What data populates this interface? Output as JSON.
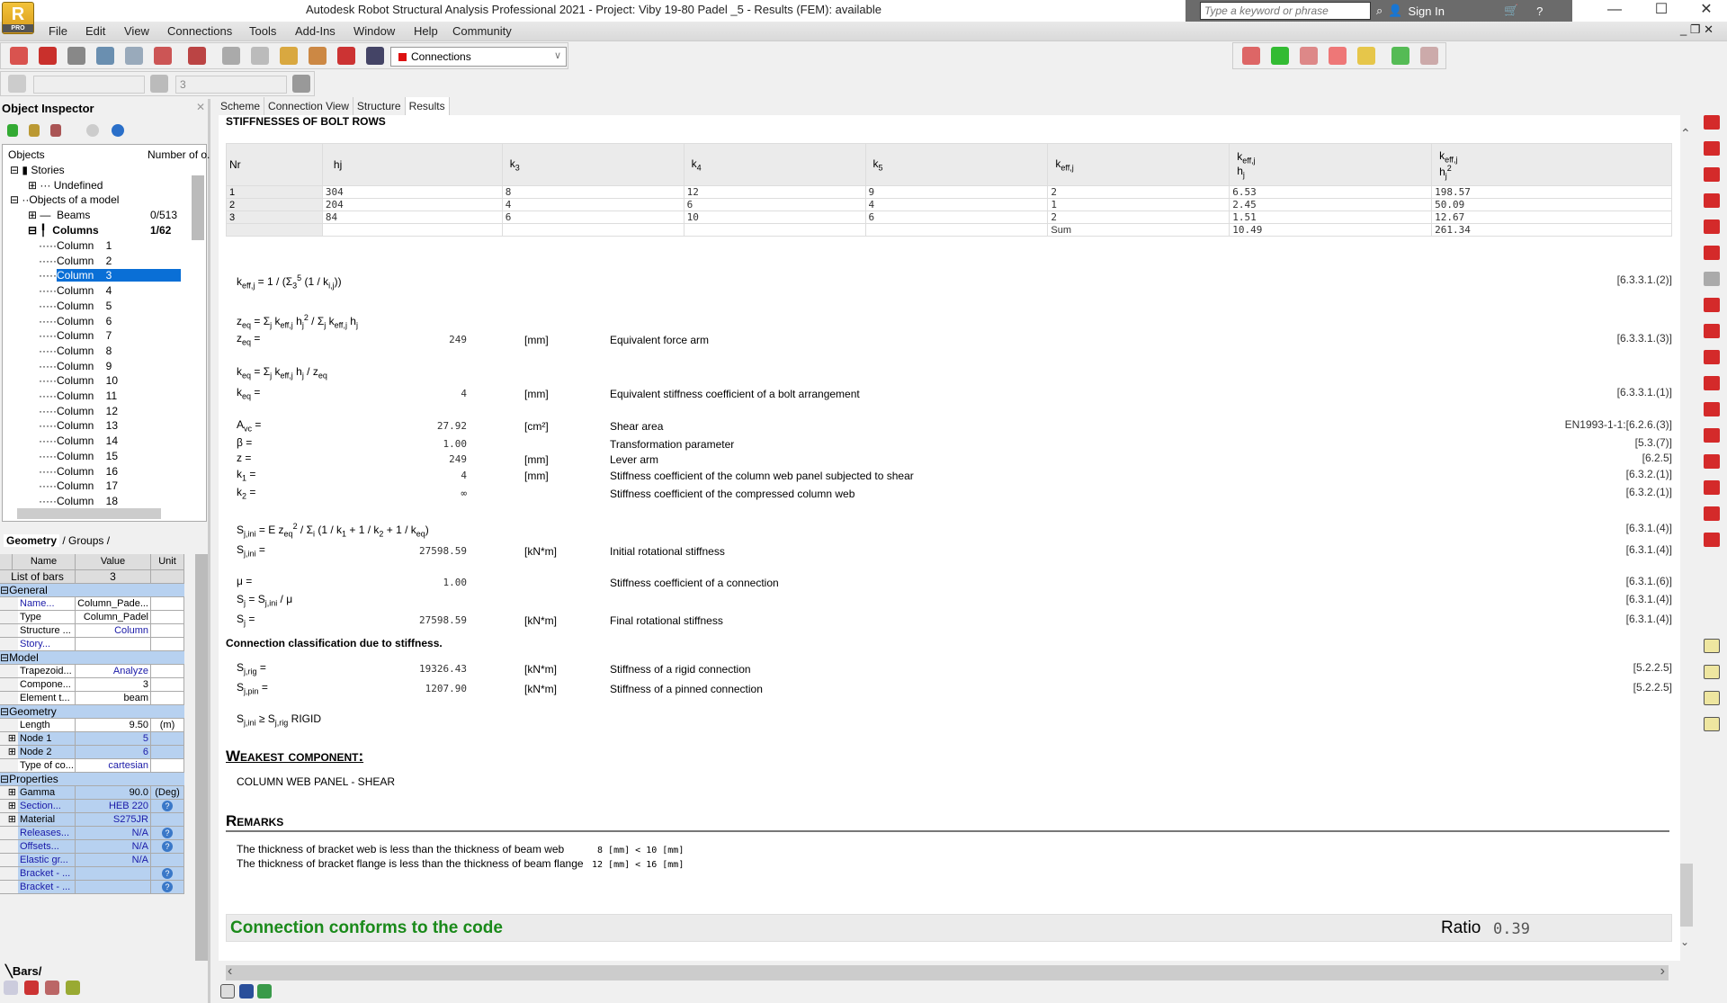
{
  "window": {
    "title": "Autodesk Robot Structural Analysis Professional 2021 - Project: Viby 19-80 Padel _5 - Results (FEM): available",
    "logo": "R",
    "logo_badge": "PRO",
    "search_placeholder": "Type a keyword or phrase",
    "sign_in": "Sign In"
  },
  "menu": [
    "File",
    "Edit",
    "View",
    "Connections",
    "Tools",
    "Add-Ins",
    "Window",
    "Help",
    "Community"
  ],
  "toolbar": {
    "connections_select": "Connections",
    "case_value": "3"
  },
  "tabs": [
    "Scheme",
    "Connection View",
    "Structure",
    "Results"
  ],
  "inspector": {
    "title": "Object Inspector",
    "col_objects": "Objects",
    "col_number": "Number of o.",
    "tree": {
      "stories": "Stories",
      "undefined": "Undefined",
      "objects": "Objects of a model",
      "beams": "Beams",
      "beams_count": "0/513",
      "columns": "Columns",
      "columns_count": "1/62"
    },
    "columns": [
      "Column    1",
      "Column    2",
      "Column    3",
      "Column    4",
      "Column    5",
      "Column    6",
      "Column    7",
      "Column    8",
      "Column    9",
      "Column    10",
      "Column    11",
      "Column    12",
      "Column    13",
      "Column    14",
      "Column    15",
      "Column    16",
      "Column    17",
      "Column    18"
    ],
    "selected_column": "Column    3",
    "bottom_tabs": [
      "Geometry",
      "Groups"
    ],
    "bars_tab": "Bars",
    "props_header": [
      "Name",
      "Value",
      "Unit"
    ],
    "props": [
      {
        "type": "top",
        "name": "List of bars",
        "value": "3",
        "unit": ""
      },
      {
        "type": "section",
        "name": "General"
      },
      {
        "name": "Name...",
        "value": "Column_Pade...",
        "unit": "",
        "blue_name": true
      },
      {
        "name": "Type",
        "value": "Column_Padel",
        "unit": ""
      },
      {
        "name": "Structure ...",
        "value": "Column",
        "unit": "",
        "blue_val": true
      },
      {
        "name": "Story...",
        "value": "",
        "unit": "",
        "blue_name": true
      },
      {
        "type": "section",
        "name": "Model"
      },
      {
        "name": "Trapezoid...",
        "value": "Analyze",
        "unit": "",
        "blue_val": true
      },
      {
        "name": "Compone...",
        "value": "3",
        "unit": ""
      },
      {
        "name": "Element t...",
        "value": "beam",
        "unit": ""
      },
      {
        "type": "section",
        "name": "Geometry"
      },
      {
        "name": "Length",
        "value": "9.50",
        "unit": "(m)"
      },
      {
        "name": "Node 1",
        "value": "5",
        "unit": "",
        "exp": true,
        "lb": true,
        "blue_val": true
      },
      {
        "name": "Node 2",
        "value": "6",
        "unit": "",
        "exp": true,
        "lb": true,
        "blue_val": true
      },
      {
        "name": "Type of co...",
        "value": "cartesian",
        "unit": "",
        "blue_val": true
      },
      {
        "type": "section",
        "name": "Properties"
      },
      {
        "name": "Gamma",
        "value": "90.0",
        "unit": "(Deg)",
        "exp": true,
        "lb": true
      },
      {
        "name": "Section...",
        "value": "HEB 220",
        "unit": "?",
        "exp": true,
        "lb": true,
        "blue_name": true,
        "blue_val": true
      },
      {
        "name": "Material",
        "value": "S275JR",
        "unit": "",
        "exp": true,
        "lb": true,
        "blue_val": true
      },
      {
        "name": "Releases...",
        "value": "N/A",
        "unit": "?",
        "lb": true,
        "blue_name": true,
        "blue_val": true
      },
      {
        "name": "Offsets...",
        "value": "N/A",
        "unit": "?",
        "lb": true,
        "blue_name": true,
        "blue_val": true
      },
      {
        "name": "Elastic gr...",
        "value": "N/A",
        "unit": "",
        "lb": true,
        "blue_name": true,
        "blue_val": true
      },
      {
        "name": "Bracket - ...",
        "value": "",
        "unit": "?",
        "lb": true,
        "blue_name": true
      },
      {
        "name": "Bracket - ...",
        "value": "",
        "unit": "?",
        "lb": true,
        "blue_name": true
      }
    ]
  },
  "results": {
    "section_title": "STIFFNESSES OF BOLT ROWS",
    "table": {
      "headers": [
        [
          [
            "Nr",
            "",
            ""
          ]
        ],
        [
          [
            "hj",
            "",
            ""
          ]
        ],
        [
          [
            "k",
            "3",
            ""
          ]
        ],
        [
          [
            "k",
            "4",
            ""
          ]
        ],
        [
          [
            "k",
            "5",
            ""
          ]
        ],
        [
          [
            "k",
            "eff,j",
            ""
          ]
        ],
        [
          [
            "k",
            "eff,j",
            ""
          ],
          [
            "<br>h",
            "j",
            ""
          ]
        ],
        [
          [
            "k",
            "eff,j",
            ""
          ],
          [
            "<br>h",
            "j",
            "2"
          ]
        ]
      ],
      "rows": [
        [
          "1",
          "304",
          "8",
          "12",
          "9",
          "2",
          "6.53",
          "198.57"
        ],
        [
          "2",
          "204",
          "4",
          "6",
          "4",
          "1",
          "2.45",
          "50.09"
        ],
        [
          "3",
          "84",
          "6",
          "10",
          "6",
          "2",
          "1.51",
          "12.67"
        ],
        [
          "",
          "",
          "",
          "",
          "",
          "Sum",
          "10.49",
          "261.34"
        ]
      ]
    },
    "lines": [
      {
        "f": [
          [
            "k",
            "eff,j",
            ""
          ],
          [
            " = 1 / (Σ",
            "3",
            "5"
          ],
          [
            " (1 / k",
            "i,j",
            ""
          ],
          [
            "))",
            "",
            ""
          ]
        ],
        "ref": "[6.3.3.1.(2)]"
      },
      {
        "f": [
          [
            "z",
            "eq",
            ""
          ],
          [
            " = Σ",
            "j",
            ""
          ],
          [
            " k",
            "eff,j",
            ""
          ],
          [
            " h",
            "j",
            "2"
          ],
          [
            " / Σ",
            "j",
            ""
          ],
          [
            " k",
            "eff,j",
            ""
          ],
          [
            " h",
            "j",
            ""
          ]
        ]
      },
      {
        "f": [
          [
            "z",
            "eq",
            ""
          ],
          [
            " =",
            "",
            ""
          ]
        ],
        "value": "249",
        "unit": "[mm]",
        "desc": "Equivalent force arm",
        "ref": "[6.3.3.1.(3)]"
      },
      {
        "f": [
          [
            "k",
            "eq",
            ""
          ],
          [
            " = Σ",
            "j",
            ""
          ],
          [
            " k",
            "eff,j",
            ""
          ],
          [
            " h",
            "j",
            ""
          ],
          [
            " / z",
            "eq",
            ""
          ]
        ]
      },
      {
        "f": [
          [
            "k",
            "eq",
            ""
          ],
          [
            " =",
            "",
            ""
          ]
        ],
        "value": "4",
        "unit": "[mm]",
        "desc": "Equivalent stiffness coefficient of a bolt arrangement",
        "ref": "[6.3.3.1.(1)]"
      },
      {
        "f": [
          [
            "A",
            "vc",
            ""
          ],
          [
            " =",
            "",
            ""
          ]
        ],
        "value": "27.92",
        "unit": "[cm²]",
        "desc": "Shear area",
        "ref": "EN1993-1-1:[6.2.6.(3)]"
      },
      {
        "f": [
          [
            "β =",
            "",
            ""
          ]
        ],
        "value": "1.00",
        "unit": "",
        "desc": "Transformation parameter",
        "ref": "[5.3.(7)]"
      },
      {
        "f": [
          [
            "z =",
            "",
            ""
          ]
        ],
        "value": "249",
        "unit": "[mm]",
        "desc": "Lever arm",
        "ref": "[6.2.5]"
      },
      {
        "f": [
          [
            "k",
            "1",
            ""
          ],
          [
            " =",
            "",
            ""
          ]
        ],
        "value": "4",
        "unit": "[mm]",
        "desc": "Stiffness coefficient of the column web panel subjected to shear",
        "ref": "[6.3.2.(1)]"
      },
      {
        "f": [
          [
            "k",
            "2",
            ""
          ],
          [
            " =",
            "",
            ""
          ]
        ],
        "value": "∞",
        "unit": "",
        "desc": "Stiffness coefficient of the compressed column web",
        "ref": "[6.3.2.(1)]"
      },
      {
        "f": [
          [
            "S",
            "j,ini",
            ""
          ],
          [
            " = E z",
            "eq",
            "2"
          ],
          [
            " / Σ",
            "i",
            ""
          ],
          [
            " (1 / k",
            "1",
            ""
          ],
          [
            " + 1 / k",
            "2",
            ""
          ],
          [
            " + 1 / k",
            "eq",
            ""
          ],
          [
            ")",
            "",
            ""
          ]
        ],
        "ref": "[6.3.1.(4)]"
      },
      {
        "f": [
          [
            "S",
            "j,ini",
            ""
          ],
          [
            " =",
            "",
            ""
          ]
        ],
        "value": "27598.59",
        "unit": "[kN*m]",
        "desc": "Initial rotational stiffness",
        "ref": "[6.3.1.(4)]"
      },
      {
        "f": [
          [
            "μ =",
            "",
            ""
          ]
        ],
        "value": "1.00",
        "unit": "",
        "desc": "Stiffness coefficient of a connection",
        "ref": "[6.3.1.(6)]"
      },
      {
        "f": [
          [
            "S",
            "j",
            ""
          ],
          [
            " = S",
            "j,ini",
            ""
          ],
          [
            " / μ",
            "",
            ""
          ]
        ],
        "ref": "[6.3.1.(4)]"
      },
      {
        "f": [
          [
            "S",
            "j",
            ""
          ],
          [
            " =",
            "",
            ""
          ]
        ],
        "value": "27598.59",
        "unit": "[kN*m]",
        "desc": "Final rotational stiffness",
        "ref": "[6.3.1.(4)]"
      },
      {
        "f": [
          [
            "S",
            "j,rig",
            ""
          ],
          [
            " =",
            "",
            ""
          ]
        ],
        "value": "19326.43",
        "unit": "[kN*m]",
        "desc": "Stiffness of a rigid connection",
        "ref": "[5.2.2.5]"
      },
      {
        "f": [
          [
            "S",
            "j,pin",
            ""
          ],
          [
            " =",
            "",
            ""
          ]
        ],
        "value": "1207.90",
        "unit": "[kN*m]",
        "desc": "Stiffness of a pinned connection",
        "ref": "[5.2.2.5]"
      },
      {
        "f": [
          [
            "S",
            "j,ini",
            ""
          ],
          [
            " ≥ S",
            "j,rig",
            ""
          ],
          [
            " RIGID",
            "",
            ""
          ]
        ]
      }
    ],
    "classification": "Connection classification due to stiffness.",
    "weakest_title": "Weakest component:",
    "weakest_value": "COLUMN WEB PANEL - SHEAR",
    "remarks_title": "Remarks",
    "remarks": [
      {
        "text": "The thickness of bracket web is less than the thickness of beam web",
        "check": " 8 [mm] < 10 [mm]"
      },
      {
        "text": "The thickness of bracket flange is less than the thickness of beam flange",
        "check": "12 [mm] < 16 [mm]"
      }
    ],
    "conform": "Connection conforms to the code",
    "ratio_label": "Ratio",
    "ratio_value": "0.39"
  },
  "colors": {
    "accent": "#0a6fd6",
    "conform": "#1a8a1a",
    "section_bg": "#b7d1f0",
    "tool_red": "#d42a2a"
  }
}
